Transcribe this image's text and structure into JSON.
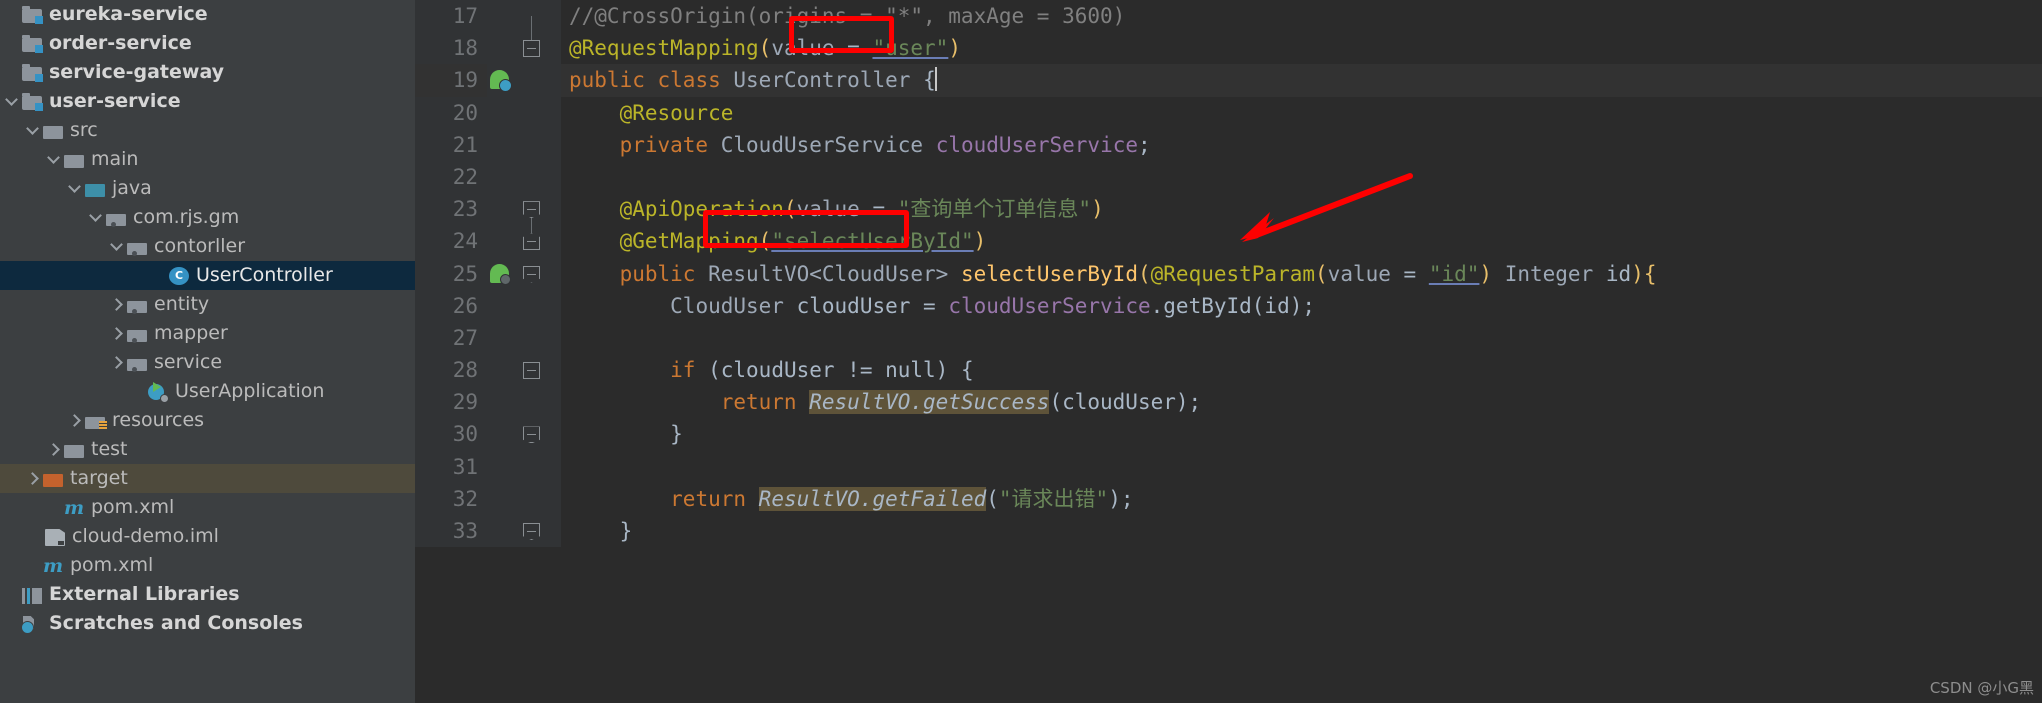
{
  "app": {
    "theme": "darcula",
    "accent_red": "#fe0000",
    "editor_bg": "#2b2b2b",
    "sidebar_bg": "#3c3f41"
  },
  "sidebar": {
    "name": "project-tree",
    "items": [
      {
        "label": "eureka-service",
        "indent": 0,
        "arrow": "none",
        "icon": "module-folder-icon",
        "state": "normal"
      },
      {
        "label": "order-service",
        "indent": 0,
        "arrow": "none",
        "icon": "module-folder-icon",
        "state": "normal"
      },
      {
        "label": "service-gateway",
        "indent": 0,
        "arrow": "none",
        "icon": "module-folder-icon",
        "state": "normal"
      },
      {
        "label": "user-service",
        "indent": 0,
        "arrow": "expanded",
        "icon": "module-folder-icon",
        "state": "normal"
      },
      {
        "label": "src",
        "indent": 1,
        "arrow": "expanded",
        "icon": "folder-icon",
        "state": "normal"
      },
      {
        "label": "main",
        "indent": 2,
        "arrow": "expanded",
        "icon": "folder-icon",
        "state": "normal"
      },
      {
        "label": "java",
        "indent": 3,
        "arrow": "expanded",
        "icon": "source-folder-icon",
        "state": "normal"
      },
      {
        "label": "com.rjs.gm",
        "indent": 4,
        "arrow": "expanded",
        "icon": "package-icon",
        "state": "normal"
      },
      {
        "label": "contorller",
        "indent": 5,
        "arrow": "expanded",
        "icon": "package-icon",
        "state": "normal"
      },
      {
        "label": "UserController",
        "indent": 7,
        "arrow": "none",
        "icon": "java-class-icon",
        "state": "selected"
      },
      {
        "label": "entity",
        "indent": 5,
        "arrow": "collapsed",
        "icon": "package-icon",
        "state": "normal"
      },
      {
        "label": "mapper",
        "indent": 5,
        "arrow": "collapsed",
        "icon": "package-icon",
        "state": "normal"
      },
      {
        "label": "service",
        "indent": 5,
        "arrow": "collapsed",
        "icon": "package-icon",
        "state": "normal"
      },
      {
        "label": "UserApplication",
        "indent": 6,
        "arrow": "none",
        "icon": "spring-boot-app-icon",
        "state": "normal"
      },
      {
        "label": "resources",
        "indent": 3,
        "arrow": "collapsed",
        "icon": "resources-folder-icon",
        "state": "normal"
      },
      {
        "label": "test",
        "indent": 2,
        "arrow": "collapsed",
        "icon": "folder-icon",
        "state": "normal"
      },
      {
        "label": "target",
        "indent": 1,
        "arrow": "collapsed",
        "icon": "target-folder-icon",
        "state": "highlight"
      },
      {
        "label": "pom.xml",
        "indent": 2,
        "arrow": "none",
        "icon": "maven-icon",
        "state": "normal"
      },
      {
        "label": "cloud-demo.iml",
        "indent": 1,
        "arrow": "none",
        "icon": "iml-file-icon",
        "state": "normal"
      },
      {
        "label": "pom.xml",
        "indent": 1,
        "arrow": "none",
        "icon": "maven-icon",
        "state": "normal"
      },
      {
        "label": "External Libraries",
        "indent": 0,
        "arrow": "none",
        "icon": "external-libraries-icon",
        "state": "normal"
      },
      {
        "label": "Scratches and Consoles",
        "indent": 0,
        "arrow": "none",
        "icon": "scratches-icon",
        "state": "normal"
      }
    ]
  },
  "editor": {
    "name": "code-editor",
    "file": "UserController",
    "language": "java",
    "first_visible_line": 17,
    "last_visible_line": 33,
    "lines": [
      {
        "n": 17,
        "marker": "",
        "fold": "",
        "text_plain": "//@CrossOrigin(origins = \"*\", maxAge = 3600)"
      },
      {
        "n": 18,
        "marker": "",
        "fold": "minus",
        "text_plain": "@RequestMapping(value = \"user\")"
      },
      {
        "n": 19,
        "marker": "spring-bean-icon",
        "fold": "",
        "text_plain": "public class UserController {"
      },
      {
        "n": 20,
        "marker": "",
        "fold": "",
        "text_plain": "    @Resource"
      },
      {
        "n": 21,
        "marker": "",
        "fold": "",
        "text_plain": "    private CloudUserService cloudUserService;"
      },
      {
        "n": 22,
        "marker": "",
        "fold": "",
        "text_plain": ""
      },
      {
        "n": 23,
        "marker": "",
        "fold": "minus-top",
        "text_plain": "    @ApiOperation(value = \"查询单个订单信息\")"
      },
      {
        "n": 24,
        "marker": "",
        "fold": "minus-bottom",
        "text_plain": "    @GetMapping(\"selectUserById\")"
      },
      {
        "n": 25,
        "marker": "spring-bean-icon",
        "fold": "minus-top",
        "text_plain": "    public ResultVO<CloudUser> selectUserById(@RequestParam(value = \"id\") Integer id){"
      },
      {
        "n": 26,
        "marker": "",
        "fold": "",
        "text_plain": "        CloudUser cloudUser = cloudUserService.getById(id);"
      },
      {
        "n": 27,
        "marker": "",
        "fold": "",
        "text_plain": ""
      },
      {
        "n": 28,
        "marker": "",
        "fold": "minus",
        "text_plain": "        if (cloudUser != null) {"
      },
      {
        "n": 29,
        "marker": "",
        "fold": "",
        "text_plain": "            return ResultVO.getSuccess(cloudUser);"
      },
      {
        "n": 30,
        "marker": "",
        "fold": "minus-bottom",
        "text_plain": "        }"
      },
      {
        "n": 31,
        "marker": "",
        "fold": "",
        "text_plain": ""
      },
      {
        "n": 32,
        "marker": "",
        "fold": "",
        "text_plain": "        return ResultVO.getFailed(\"请求出错\");"
      },
      {
        "n": 33,
        "marker": "",
        "fold": "minus-bottom",
        "text_plain": "    }"
      }
    ],
    "tokens": {
      "l17_comment": "//@CrossOrigin(origins = \"*\", maxAge = 3600)",
      "l18_anno": "@RequestMapping",
      "l18_paren_open": "(",
      "l18_value": "value",
      "l18_eq": " = ",
      "l18_str": "\"user\"",
      "l18_paren_close": ")",
      "l19_public": "public",
      "l19_class": "class",
      "l19_name": "UserController",
      "l19_brace": "{",
      "l20_anno": "@Resource",
      "l21_private": "private",
      "l21_type": "CloudUserService",
      "l21_field": "cloudUserService",
      "l21_semi": ";",
      "l23_anno": "@ApiOperation",
      "l23_value": "value",
      "l23_str": "\"查询单个订单信息\"",
      "l24_anno": "@GetMapping",
      "l24_str": "\"selectUserById\"",
      "l25_public": "public",
      "l25_type": "ResultVO<CloudUser>",
      "l25_method": "selectUserById",
      "l25_anno": "@RequestParam",
      "l25_value": "value",
      "l25_str": "\"id\"",
      "l25_paramtype": "Integer",
      "l25_paramname": "id",
      "l25_brace": "){",
      "l26_type": "CloudUser",
      "l26_var": "cloudUser",
      "l26_field": "cloudUserService",
      "l26_call": ".getById(id);",
      "l28_if": "if",
      "l28_cond": "(cloudUser != null) {",
      "l29_return": "return",
      "l29_static": "ResultVO.getSuccess",
      "l29_args": "(cloudUser);",
      "l30_close": "}",
      "l32_return": "return",
      "l32_static": "ResultVO.getFailed",
      "l32_str": "\"请求出错\"",
      "l32_tail": ");",
      "l33_close": "}"
    }
  },
  "annotations": {
    "box_user": {
      "name": "red-box-user-mapping",
      "label": "\"user\""
    },
    "box_selectuserbyid": {
      "name": "red-box-selectuserbyid",
      "label": "\"selectUserById\""
    },
    "arrow": {
      "name": "red-arrow-annotation",
      "color": "#fe0000"
    }
  },
  "watermark": {
    "text": "CSDN @小G黑"
  }
}
